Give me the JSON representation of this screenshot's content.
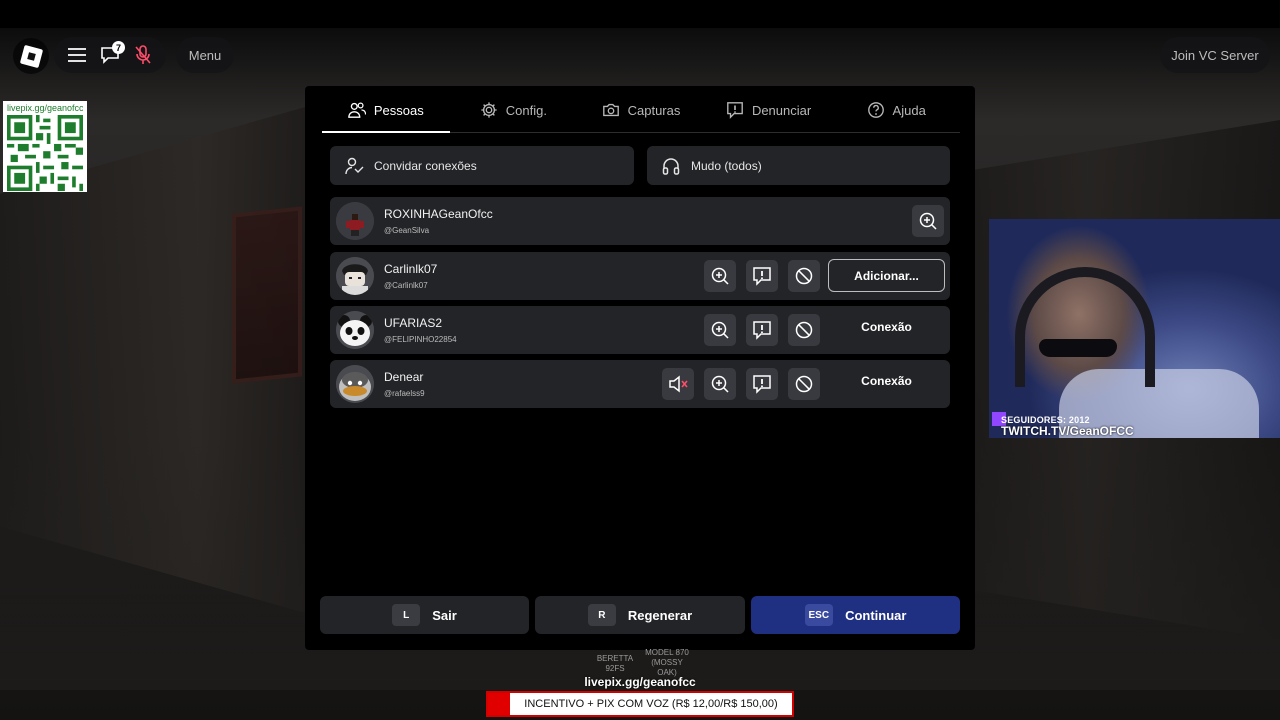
{
  "topbar": {
    "badge_count": "7",
    "menu_label": "Menu",
    "vc_label": "Join VC Server"
  },
  "qr": {
    "label": "livepix.gg/geanofcc"
  },
  "webcam": {
    "subs_label": "SEGUIDORES: 2012",
    "channel": "TWITCH.TV/GeanOFCC"
  },
  "tabs": [
    {
      "label": "Pessoas",
      "icon": "people-icon",
      "active": true
    },
    {
      "label": "Config.",
      "icon": "gear-icon",
      "active": false
    },
    {
      "label": "Capturas",
      "icon": "camera-icon",
      "active": false
    },
    {
      "label": "Denunciar",
      "icon": "report-icon",
      "active": false
    },
    {
      "label": "Ajuda",
      "icon": "help-icon",
      "active": false
    }
  ],
  "actions": {
    "invite_label": "Convidar conexões",
    "mute_label": "Mudo (todos)"
  },
  "players": [
    {
      "name": "ROXINHAGeanOfcc",
      "handle": "@GeanSilva"
    },
    {
      "name": "Carlinlk07",
      "handle": "@Carlinlk07",
      "button": "Adicionar..."
    },
    {
      "name": "UFARIAS2",
      "handle": "@FELIPINHO22854",
      "status": "Conexão"
    },
    {
      "name": "Denear",
      "handle": "@rafaelss9",
      "status": "Conexão"
    }
  ],
  "bottom": {
    "leave_key": "L",
    "leave_label": "Sair",
    "reset_key": "R",
    "reset_label": "Regenerar",
    "resume_key": "ESC",
    "resume_label": "Continuar"
  },
  "hud": {
    "weapon1": "BERETTA 92FS",
    "weapon2": "MODEL 870 (MOSSY OAK)",
    "livepix": "livepix.gg/geanofcc",
    "incentive": "INCENTIVO + PIX COM VOZ (R$ 12,00/R$ 150,00)"
  },
  "colors": {
    "accent_blue": "#1f2f82",
    "panel": "#232427",
    "twitch_purple": "#9146ff",
    "alert_red": "#e00000"
  }
}
